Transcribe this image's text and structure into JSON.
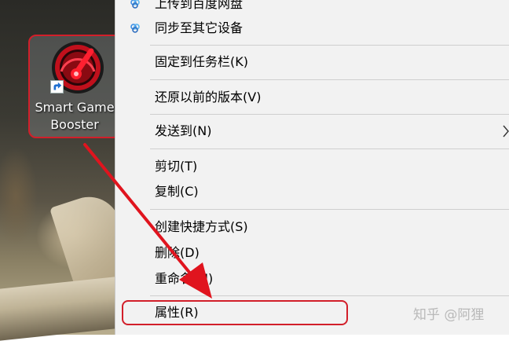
{
  "desktop": {
    "icon_label_line1": "Smart Game",
    "icon_label_line2": "Booster",
    "highlight_color": "#d21f2a"
  },
  "menu": {
    "items": [
      {
        "label": "上传到百度网盘",
        "icon": "baidu-cloud-icon"
      },
      {
        "label": "同步至其它设备",
        "icon": "baidu-cloud-icon"
      },
      {
        "label": "固定到任务栏(K)"
      },
      {
        "label": "还原以前的版本(V)"
      },
      {
        "label": "发送到(N)",
        "submenu": true
      },
      {
        "label": "剪切(T)"
      },
      {
        "label": "复制(C)"
      },
      {
        "label": "创建快捷方式(S)"
      },
      {
        "label": "删除(D)"
      },
      {
        "label": "重命名(M)"
      },
      {
        "label": "属性(R)"
      }
    ]
  },
  "watermark": "知乎 @阿狸"
}
